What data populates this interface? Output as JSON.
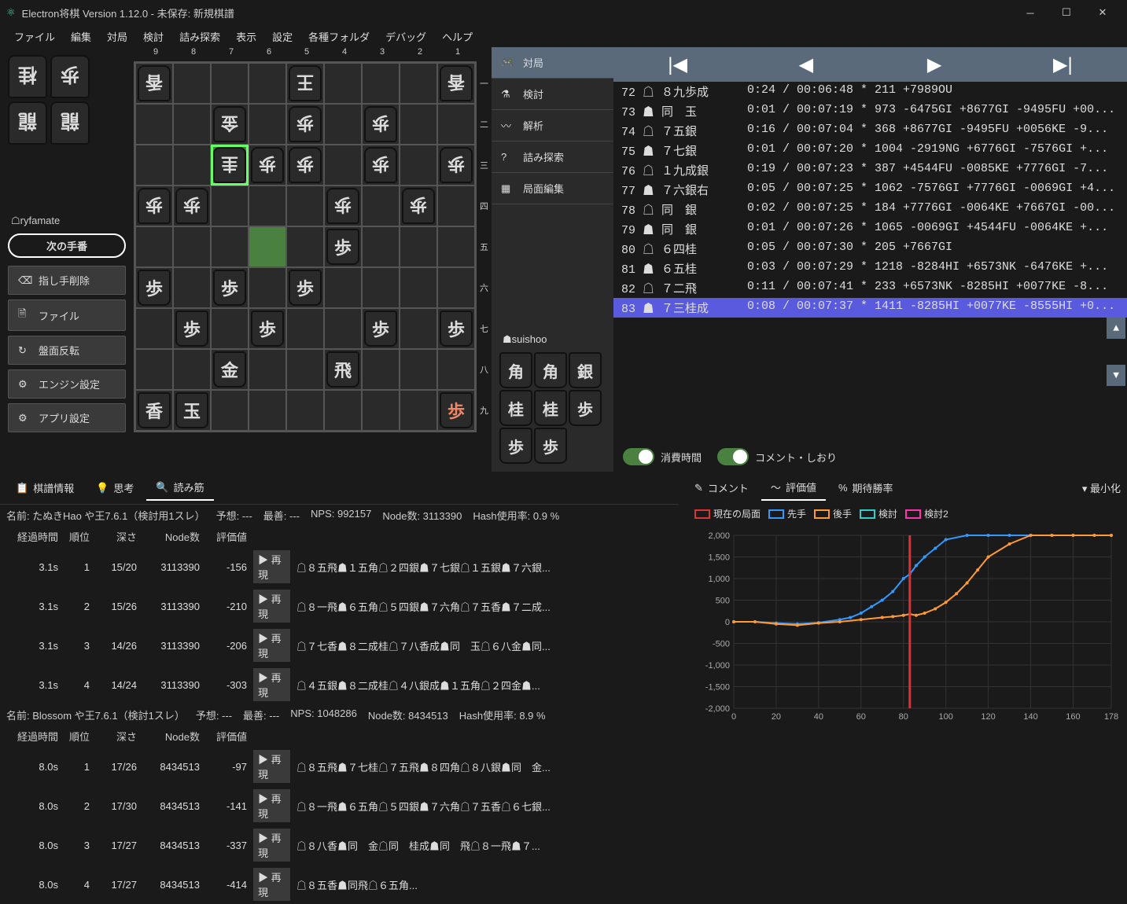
{
  "window": {
    "title": "Electron将棋 Version 1.12.0 - 未保存: 新規棋譜"
  },
  "menubar": [
    "ファイル",
    "編集",
    "対局",
    "検討",
    "詰み探索",
    "表示",
    "設定",
    "各種フォルダ",
    "デバッグ",
    "ヘルプ"
  ],
  "players": {
    "white": "ryfamate",
    "black": "suishoo",
    "turn_label": "次の手番"
  },
  "left_buttons": [
    {
      "icon": "⌫",
      "label": "指し手削除"
    },
    {
      "icon": "🗎",
      "label": "ファイル"
    },
    {
      "icon": "↻",
      "label": "盤面反転"
    },
    {
      "icon": "⚙",
      "label": "エンジン設定"
    },
    {
      "icon": "⚙",
      "label": "アプリ設定"
    }
  ],
  "white_hand": [
    "桂",
    "歩",
    "龍",
    "龍"
  ],
  "black_hand": [
    "角",
    "角",
    "銀",
    "桂",
    "桂",
    "歩",
    "歩",
    "歩"
  ],
  "mid_tabs": [
    {
      "icon": "🎮",
      "label": "対局",
      "sel": true
    },
    {
      "icon": "⚗",
      "label": "検討"
    },
    {
      "icon": "〰",
      "label": "解析"
    },
    {
      "icon": "?",
      "label": "詰み探索"
    },
    {
      "icon": "▦",
      "label": "局面編集"
    }
  ],
  "file_labels": [
    "9",
    "8",
    "7",
    "6",
    "5",
    "4",
    "3",
    "2",
    "1"
  ],
  "rank_labels": [
    "一",
    "二",
    "三",
    "四",
    "五",
    "六",
    "七",
    "八",
    "九"
  ],
  "board": [
    [
      "香i",
      "",
      "",
      "",
      "王i",
      "",
      "",
      "",
      "香i"
    ],
    [
      "",
      "",
      "金i",
      "",
      "歩i",
      "",
      "歩i",
      "",
      ""
    ],
    [
      "",
      "",
      "圭i hl",
      "歩i",
      "歩i",
      "",
      "歩i",
      "",
      "歩i"
    ],
    [
      "歩i",
      "歩i",
      "",
      "",
      "",
      "歩i",
      "",
      "歩i",
      ""
    ],
    [
      "",
      "",
      "",
      "hl2",
      "",
      "歩",
      "",
      "",
      ""
    ],
    [
      "歩",
      "",
      "歩",
      "",
      "歩",
      "",
      "",
      "",
      ""
    ],
    [
      "",
      "歩",
      "",
      "歩",
      "",
      "",
      "歩",
      "",
      "歩"
    ],
    [
      "",
      "",
      "金",
      "",
      "",
      "飛",
      "",
      "",
      ""
    ],
    [
      "香",
      "玉",
      "",
      "",
      "",
      "",
      "",
      "",
      "歩p"
    ]
  ],
  "moves": [
    {
      "n": "72",
      "side": "☖",
      "m": "８九歩成",
      "d": "0:24 / 00:06:48 * 211 +7989OU"
    },
    {
      "n": "73",
      "side": "☗",
      "m": "同　玉",
      "d": "0:01 / 00:07:19 * 973 -6475GI +8677GI -9495FU +00..."
    },
    {
      "n": "74",
      "side": "☖",
      "m": "７五銀",
      "d": "0:16 / 00:07:04 * 368 +8677GI -9495FU +0056KE -9..."
    },
    {
      "n": "75",
      "side": "☗",
      "m": "７七銀",
      "d": "0:01 / 00:07:20 * 1004 -2919NG +6776GI -7576GI +..."
    },
    {
      "n": "76",
      "side": "☖",
      "m": "１九成銀",
      "d": "0:19 / 00:07:23 * 387 +4544FU -0085KE +7776GI -7..."
    },
    {
      "n": "77",
      "side": "☗",
      "m": "７六銀右",
      "d": "0:05 / 00:07:25 * 1062 -7576GI +7776GI -0069GI +4..."
    },
    {
      "n": "78",
      "side": "☖",
      "m": "同　銀",
      "d": "0:02 / 00:07:25 * 184 +7776GI -0064KE +7667GI -00..."
    },
    {
      "n": "79",
      "side": "☗",
      "m": "同　銀",
      "d": "0:01 / 00:07:26 * 1065 -0069GI +4544FU -0064KE +..."
    },
    {
      "n": "80",
      "side": "☖",
      "m": "６四桂",
      "d": "0:05 / 00:07:30 * 205 +7667GI"
    },
    {
      "n": "81",
      "side": "☗",
      "m": "６五桂",
      "d": "0:03 / 00:07:29 * 1218 -8284HI +6573NK -6476KE +..."
    },
    {
      "n": "82",
      "side": "☖",
      "m": "７二飛",
      "d": "0:11 / 00:07:41 * 233 +6573NK -8285HI +0077KE -8..."
    },
    {
      "n": "83",
      "side": "☗",
      "m": "７三桂成",
      "d": "0:08 / 00:07:37 * 1411 -8285HI +0077KE -8555HI +0...",
      "sel": true
    }
  ],
  "toggles": {
    "t1": "消費時間",
    "t2": "コメント・しおり"
  },
  "analysis_tabs": [
    {
      "icon": "📋",
      "label": "棋譜情報"
    },
    {
      "icon": "💡",
      "label": "思考"
    },
    {
      "icon": "🔍",
      "label": "読み筋",
      "sel": true
    }
  ],
  "engines": [
    {
      "header_items": [
        "名前: たぬきHao や王7.6.1（検討用1スレ）",
        "予想: ---",
        "最善: ---",
        "NPS: 992157",
        "Node数: 3113390",
        "Hash使用率: 0.9 %"
      ],
      "cols": [
        "経過時間",
        "順位",
        "深さ",
        "Node数",
        "評価値"
      ],
      "rows": [
        {
          "t": "3.1s",
          "r": "1",
          "d": "15/20",
          "n": "3113390",
          "e": "-156",
          "pv": "☖８五飛☗１五角☖２四銀☗７七銀☖１五銀☗７六銀..."
        },
        {
          "t": "3.1s",
          "r": "2",
          "d": "15/26",
          "n": "3113390",
          "e": "-210",
          "pv": "☖８一飛☗６五角☖５四銀☗７六角☖７五香☗７二成..."
        },
        {
          "t": "3.1s",
          "r": "3",
          "d": "14/26",
          "n": "3113390",
          "e": "-206",
          "pv": "☖７七香☗８二成桂☖７八香成☗同　玉☖６八金☗同..."
        },
        {
          "t": "3.1s",
          "r": "4",
          "d": "14/24",
          "n": "3113390",
          "e": "-303",
          "pv": "☖４五銀☗８二成桂☖４八銀成☗１五角☖２四金☗..."
        }
      ]
    },
    {
      "header_items": [
        "名前: Blossom や王7.6.1（検討1スレ）",
        "予想: ---",
        "最善: ---",
        "NPS: 1048286",
        "Node数: 8434513",
        "Hash使用率: 8.9 %"
      ],
      "cols": [
        "経過時間",
        "順位",
        "深さ",
        "Node数",
        "評価値"
      ],
      "rows": [
        {
          "t": "8.0s",
          "r": "1",
          "d": "17/26",
          "n": "8434513",
          "e": "-97",
          "pv": "☖８五飛☗７七桂☖７五飛☗８四角☖８八銀☗同　金..."
        },
        {
          "t": "8.0s",
          "r": "2",
          "d": "17/30",
          "n": "8434513",
          "e": "-141",
          "pv": "☖８一飛☗６五角☖５四銀☗７六角☖７五香☖６七銀..."
        },
        {
          "t": "8.0s",
          "r": "3",
          "d": "17/27",
          "n": "8434513",
          "e": "-337",
          "pv": "☖８八香☗同　金☖同　桂成☗同　飛☖８一飛☗７..."
        },
        {
          "t": "8.0s",
          "r": "4",
          "d": "17/27",
          "n": "8434513",
          "e": "-414",
          "pv": "☖８五香☗同飛☖６五角..."
        }
      ]
    }
  ],
  "repro_label": "再現",
  "chart_tabs": [
    {
      "icon": "✎",
      "label": "コメント"
    },
    {
      "icon": "〜",
      "label": "評価値",
      "sel": true
    },
    {
      "icon": "%",
      "label": "期待勝率"
    }
  ],
  "chart_minimize": "最小化",
  "legend": [
    {
      "color": "#d33",
      "label": "現在の局面"
    },
    {
      "color": "#39f",
      "label": "先手"
    },
    {
      "color": "#f93",
      "label": "後手"
    },
    {
      "color": "#3cc",
      "label": "検討"
    },
    {
      "color": "#f3a",
      "label": "検討2"
    }
  ],
  "chart_data": {
    "type": "line",
    "xlabel": "",
    "ylabel": "",
    "xlim": [
      0,
      178
    ],
    "ylim": [
      -2000,
      2000
    ],
    "xticks": [
      0,
      20,
      40,
      60,
      80,
      100,
      120,
      140,
      160,
      178
    ],
    "yticks": [
      -2000,
      -1500,
      -1000,
      -500,
      0,
      500,
      1000,
      1500,
      2000
    ],
    "current_move": 83,
    "series": [
      {
        "name": "先手",
        "color": "#39f",
        "x": [
          0,
          10,
          20,
          30,
          40,
          50,
          55,
          60,
          65,
          70,
          75,
          80,
          83,
          86,
          90,
          95,
          100,
          110,
          120,
          130,
          140,
          150,
          160,
          170,
          178
        ],
        "y": [
          0,
          0,
          -30,
          -50,
          -20,
          50,
          100,
          200,
          350,
          500,
          700,
          1000,
          1100,
          1300,
          1500,
          1700,
          1900,
          2000,
          2000,
          2000,
          2000,
          2000,
          2000,
          2000,
          2000
        ]
      },
      {
        "name": "後手",
        "color": "#f93",
        "x": [
          0,
          10,
          20,
          30,
          40,
          50,
          60,
          70,
          75,
          80,
          83,
          86,
          90,
          95,
          100,
          105,
          110,
          115,
          120,
          130,
          140,
          150,
          160,
          170,
          178
        ],
        "y": [
          0,
          0,
          -50,
          -80,
          -30,
          0,
          50,
          100,
          120,
          150,
          180,
          150,
          200,
          300,
          450,
          650,
          900,
          1200,
          1500,
          1800,
          2000,
          2000,
          2000,
          2000,
          2000
        ]
      }
    ]
  }
}
